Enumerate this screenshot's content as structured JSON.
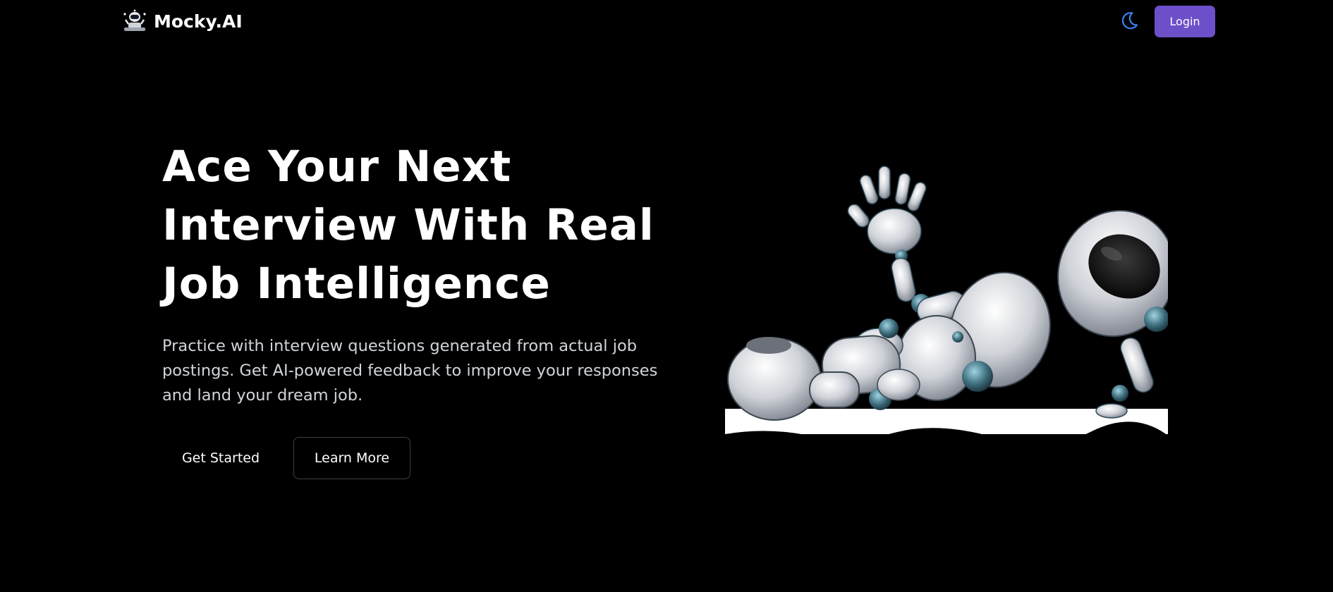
{
  "header": {
    "brand_name": "Mocky.AI",
    "logo_icon": "robot-logo-icon",
    "theme_toggle_icon": "moon-icon",
    "login_label": "Login"
  },
  "hero": {
    "title_lines": [
      "Ace Your Next",
      "Interview With Real",
      "Job Intelligence"
    ],
    "subtitle": "Practice with interview questions generated from actual job postings. Get AI-powered feedback to improve your responses and land your dream job.",
    "primary_button_label": "Get Started",
    "secondary_button_label": "Learn More",
    "illustration_icon": "robot-illustration-icon"
  },
  "colors": {
    "background": "#000000",
    "accent": "#6d4fc9",
    "moon": "#3b82f6",
    "text_primary": "#ffffff",
    "text_secondary": "#d1d5db",
    "border": "#3f3f46"
  }
}
